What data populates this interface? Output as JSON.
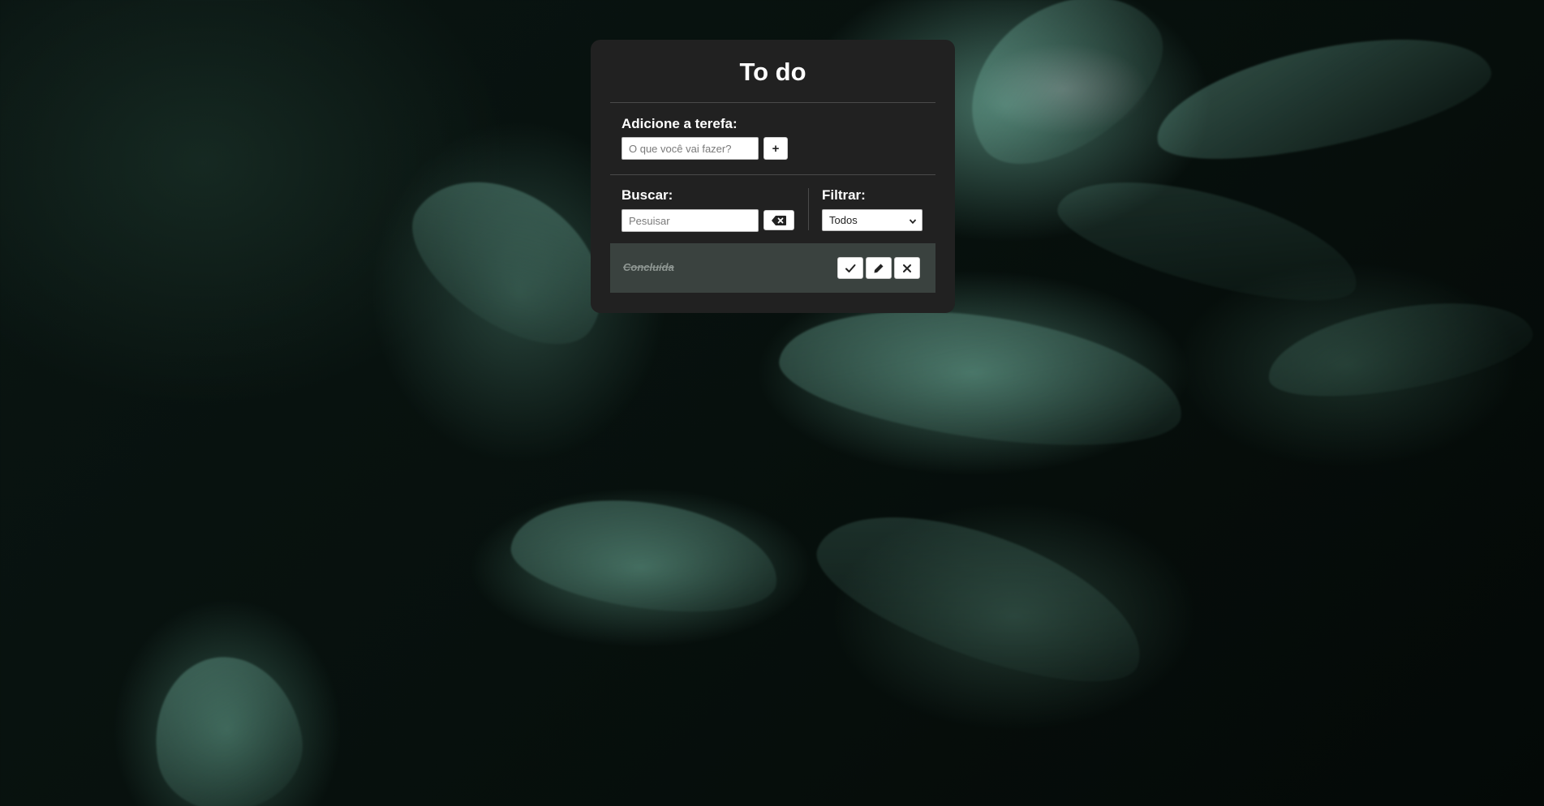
{
  "app": {
    "title": "To do"
  },
  "add_task": {
    "label": "Adicione a terefa:",
    "input_placeholder": "O que você vai fazer?",
    "add_button_label": "+"
  },
  "search": {
    "label": "Buscar:",
    "input_placeholder": "Pesuisar",
    "clear_icon": "backspace-icon"
  },
  "filter": {
    "label": "Filtrar:",
    "selected": "Todos"
  },
  "todos": [
    {
      "text": "Concluída",
      "done": true,
      "actions": [
        "check-icon",
        "pencil-icon",
        "close-icon"
      ]
    }
  ],
  "colors": {
    "card_background": "#212121",
    "todo_done_background": "#3a423f",
    "text": "#ffffff"
  }
}
